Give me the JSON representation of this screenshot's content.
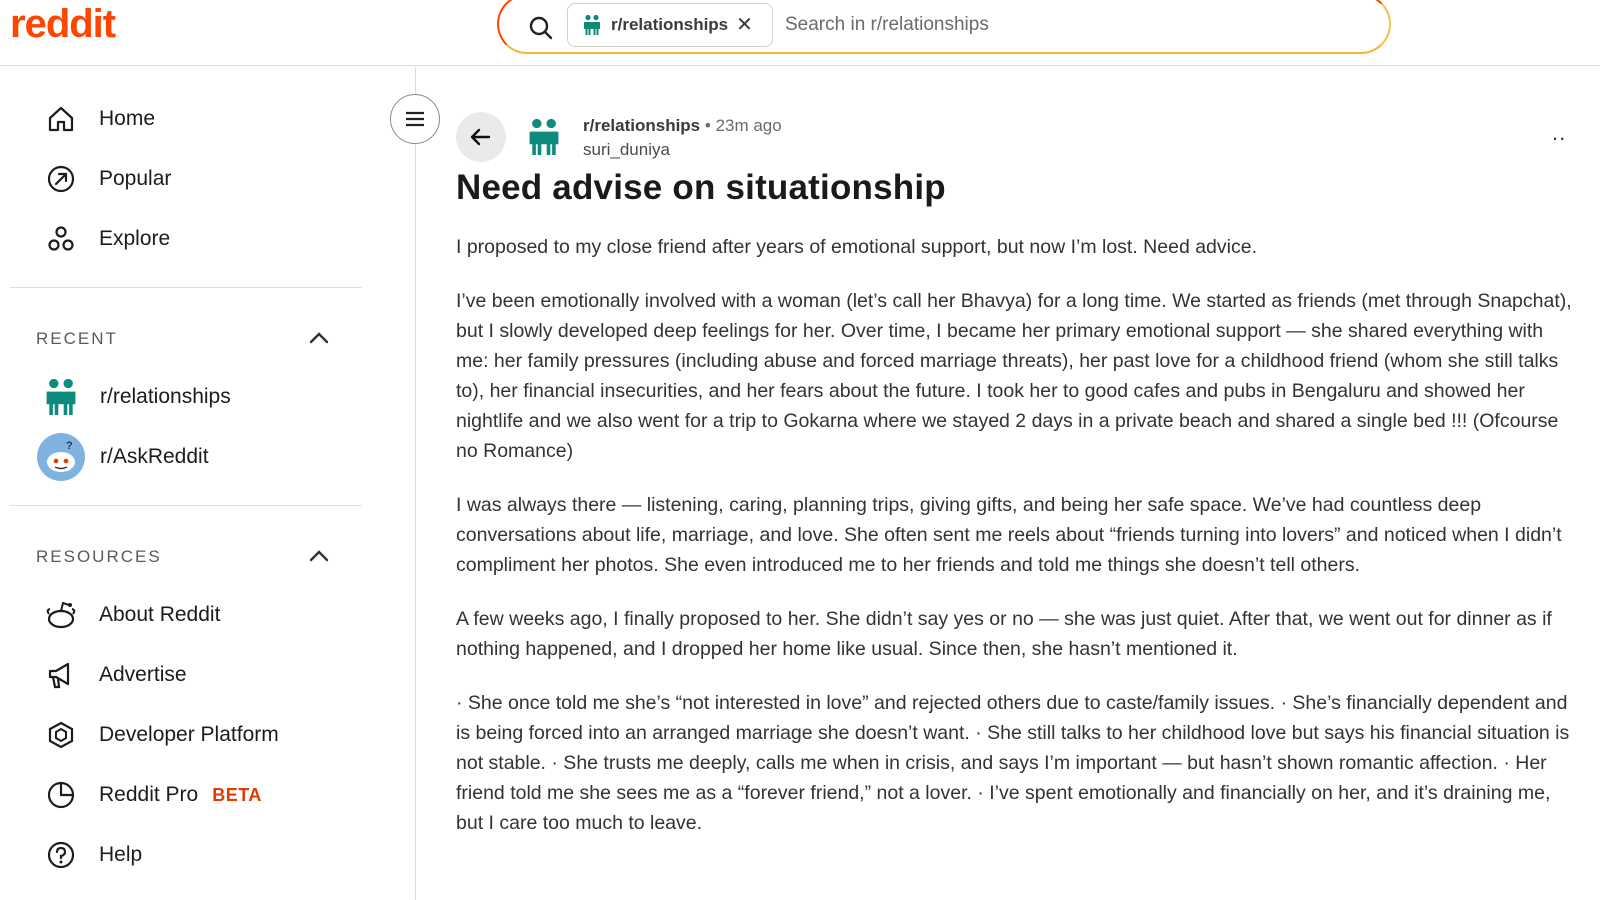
{
  "header": {
    "logo": "reddit",
    "search": {
      "chip_label": "r/relationships",
      "chip_close": "✕",
      "placeholder": "Search in r/relationships"
    }
  },
  "sidebar": {
    "nav": [
      {
        "label": "Home",
        "icon": "home-icon"
      },
      {
        "label": "Popular",
        "icon": "popular-icon"
      },
      {
        "label": "Explore",
        "icon": "explore-icon"
      }
    ],
    "recent": {
      "heading": "RECENT",
      "items": [
        {
          "label": "r/relationships",
          "icon": "relationships-community-icon"
        },
        {
          "label": "r/AskReddit",
          "icon": "askreddit-community-icon"
        }
      ]
    },
    "resources": {
      "heading": "RESOURCES",
      "items": [
        {
          "label": "About Reddit",
          "icon": "about-reddit-icon"
        },
        {
          "label": "Advertise",
          "icon": "megaphone-icon"
        },
        {
          "label": "Developer Platform",
          "icon": "developer-platform-icon"
        },
        {
          "label": "Reddit Pro",
          "icon": "reddit-pro-icon",
          "badge": "BETA"
        },
        {
          "label": "Help",
          "icon": "help-icon"
        }
      ]
    }
  },
  "post": {
    "subreddit": "r/relationships",
    "separator": "•",
    "time": "23m ago",
    "author": "suri_duniya",
    "more": "..",
    "title": "Need advise on situationship",
    "paragraphs": [
      "I proposed to my close friend after years of emotional support, but now I’m lost. Need advice.",
      "I’ve been emotionally involved with a woman (let’s call her Bhavya) for a long time. We started as friends (met through Snapchat), but I slowly developed deep feelings for her. Over time, I became her primary emotional support — she shared everything with me: her family pressures (including abuse and forced marriage threats), her past love for a childhood friend (whom she still talks to), her financial insecurities, and her fears about the future. I took her to good cafes and pubs in Bengaluru and showed her nightlife and we also went for a trip to Gokarna where we stayed 2 days in a private beach and shared a single bed !!! (Ofcourse no Romance)",
      "I was always there — listening, caring, planning trips, giving gifts, and being her safe space. We’ve had countless deep conversations about life, marriage, and love. She often sent me reels about “friends turning into lovers” and noticed when I didn’t compliment her photos. She even introduced me to her friends and told me things she doesn’t tell others.",
      "A few weeks ago, I finally proposed to her. She didn’t say yes or no — she was just quiet. After that, we went out for dinner as if nothing happened, and I dropped her home like usual. Since then, she hasn’t mentioned it.",
      "· She once told me she’s “not interested in love” and rejected others due to caste/family issues. · She’s financially dependent and is being forced into an arranged marriage she doesn’t want. · She still talks to her childhood love but says his financial situation is not stable. · She trusts me deeply, calls me when in crisis, and says I’m important — but hasn’t shown romantic affection. · Her friend told me she sees me as a “forever friend,” not a lover. · I’ve spent emotionally and financially on her, and it’s draining me, but I care too much to leave."
    ]
  },
  "colors": {
    "brand": "#ff4500",
    "community_teal": "#0d8b7d",
    "beta": "#e23d00"
  }
}
